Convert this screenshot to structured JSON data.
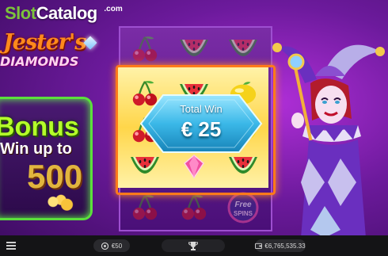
{
  "watermark": {
    "part1": "Slot",
    "part2": "Catalog",
    "suffix": ".com"
  },
  "game": {
    "logo_line1": "Jester's",
    "logo_line2": "DIAMONDS"
  },
  "promo": {
    "title": "Bonus",
    "line": "Win up to",
    "amount": "500"
  },
  "total_win": {
    "label": "Total Win",
    "value": "€ 25"
  },
  "reels": {
    "rows": [
      [
        "cherries",
        "watermelon",
        "watermelon"
      ],
      [
        "cherries",
        "watermelon",
        "lemon"
      ],
      [
        "cherries",
        "lemon",
        "lemon"
      ],
      [
        "watermelon",
        "diamond",
        "watermelon"
      ],
      [
        "cherries",
        "cherries",
        "free-spins"
      ]
    ],
    "free_spins_label_1": "Free",
    "free_spins_label_2": "SPINS"
  },
  "bottom_bar": {
    "bet": "€50",
    "balance": "€6,765,535.33"
  },
  "colors": {
    "win_frame": "#ff7a1a",
    "total_win_panel": "#4ec8ee",
    "promo_border": "#5be03c",
    "logo_orange": "#ff8a1c"
  }
}
